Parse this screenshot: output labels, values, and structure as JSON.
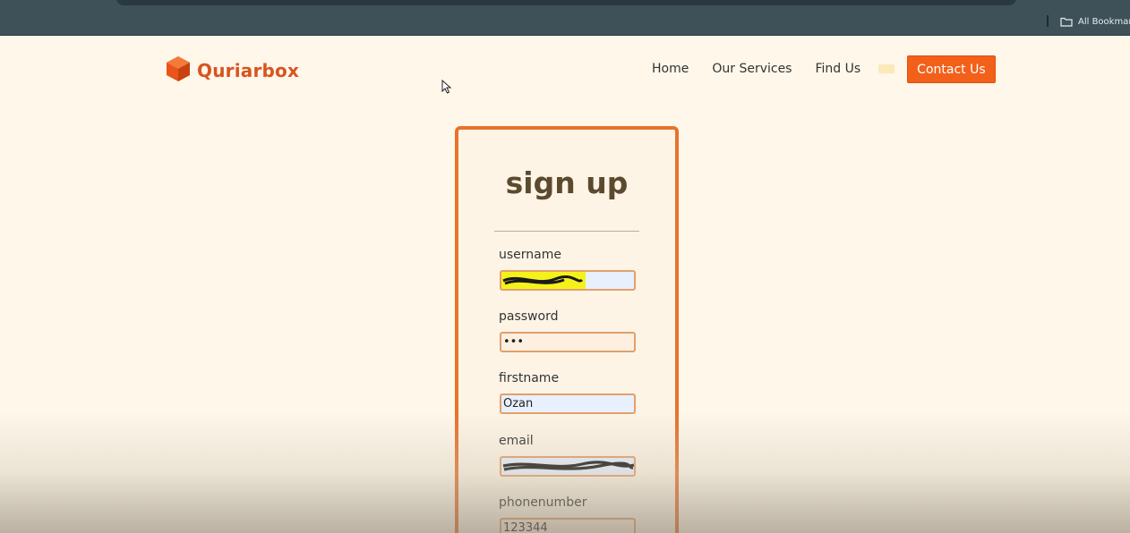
{
  "browser": {
    "bookmarks_label": "All Bookmark"
  },
  "header": {
    "logo_text": "Quriarbox",
    "nav": {
      "home": "Home",
      "services": "Our Services",
      "find_us": "Find Us",
      "contact": "Contact Us"
    }
  },
  "signup": {
    "title": "sign up",
    "fields": {
      "username": {
        "label": "username",
        "value": ""
      },
      "password": {
        "label": "password",
        "value": "•••"
      },
      "firstname": {
        "label": "firstname",
        "value": "Ozan"
      },
      "email": {
        "label": "email",
        "value": ""
      },
      "phonenumber": {
        "label": "phonenumber",
        "value": "123344"
      }
    }
  },
  "colors": {
    "accent": "#f2601a",
    "card_border": "#e7732c",
    "page_bg": "#fef7ea",
    "title": "#5b4a2e"
  },
  "icons": {
    "logo": "cube-icon",
    "bookmarks": "folder-icon",
    "cursor": "mouse-pointer-icon"
  }
}
